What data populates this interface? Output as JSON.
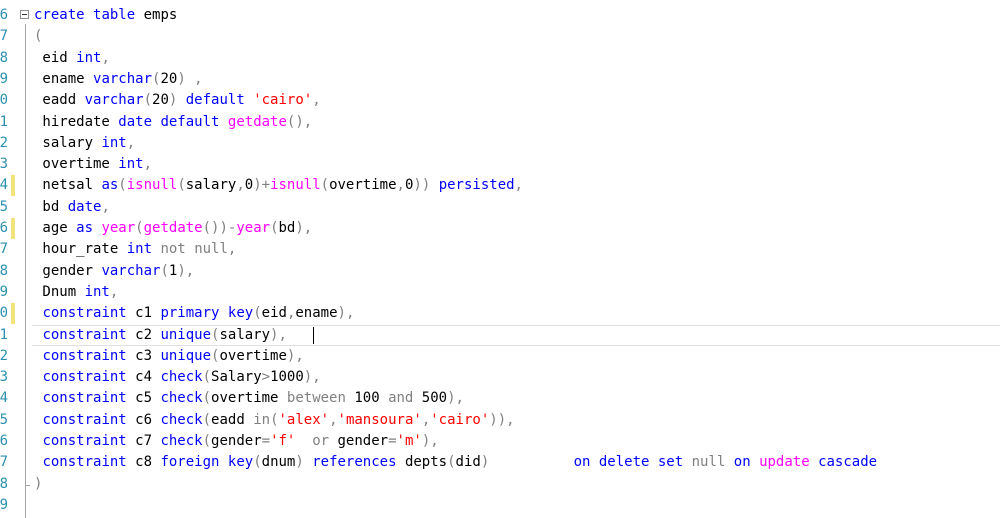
{
  "editor": {
    "line_numbers": [
      "6",
      "7",
      "8",
      "9",
      "0",
      "1",
      "2",
      "3",
      "4",
      "5",
      "6",
      "7",
      "8",
      "9",
      "0",
      "1",
      "2",
      "3",
      "4",
      "5",
      "6",
      "7",
      "8",
      "9"
    ],
    "changed_lines": [
      8,
      10,
      14
    ],
    "caret_line": 15,
    "lines": [
      [
        {
          "t": "create",
          "c": "kw"
        },
        {
          "t": " ",
          "c": "txt"
        },
        {
          "t": "table",
          "c": "kw"
        },
        {
          "t": " emps",
          "c": "txt"
        }
      ],
      [
        {
          "t": "(",
          "c": "gray"
        }
      ],
      [
        {
          "t": " eid ",
          "c": "txt"
        },
        {
          "t": "int",
          "c": "kw"
        },
        {
          "t": ",",
          "c": "gray"
        }
      ],
      [
        {
          "t": " ename ",
          "c": "txt"
        },
        {
          "t": "varchar",
          "c": "kw"
        },
        {
          "t": "(",
          "c": "gray"
        },
        {
          "t": "20",
          "c": "txt"
        },
        {
          "t": ") ,",
          "c": "gray"
        }
      ],
      [
        {
          "t": " eadd ",
          "c": "txt"
        },
        {
          "t": "varchar",
          "c": "kw"
        },
        {
          "t": "(",
          "c": "gray"
        },
        {
          "t": "20",
          "c": "txt"
        },
        {
          "t": ") ",
          "c": "gray"
        },
        {
          "t": "default",
          "c": "kw"
        },
        {
          "t": " ",
          "c": "txt"
        },
        {
          "t": "'cairo'",
          "c": "str"
        },
        {
          "t": ",",
          "c": "gray"
        }
      ],
      [
        {
          "t": " hiredate ",
          "c": "txt"
        },
        {
          "t": "date",
          "c": "kw"
        },
        {
          "t": " ",
          "c": "txt"
        },
        {
          "t": "default",
          "c": "kw"
        },
        {
          "t": " ",
          "c": "txt"
        },
        {
          "t": "getdate",
          "c": "fn"
        },
        {
          "t": "(),",
          "c": "gray"
        }
      ],
      [
        {
          "t": " salary ",
          "c": "txt"
        },
        {
          "t": "int",
          "c": "kw"
        },
        {
          "t": ",",
          "c": "gray"
        }
      ],
      [
        {
          "t": " overtime ",
          "c": "txt"
        },
        {
          "t": "int",
          "c": "kw"
        },
        {
          "t": ",",
          "c": "gray"
        }
      ],
      [
        {
          "t": " netsal ",
          "c": "txt"
        },
        {
          "t": "as",
          "c": "kw"
        },
        {
          "t": "(",
          "c": "gray"
        },
        {
          "t": "isnull",
          "c": "fn"
        },
        {
          "t": "(",
          "c": "gray"
        },
        {
          "t": "salary",
          "c": "txt"
        },
        {
          "t": ",",
          "c": "gray"
        },
        {
          "t": "0",
          "c": "txt"
        },
        {
          "t": ")+",
          "c": "gray"
        },
        {
          "t": "isnull",
          "c": "fn"
        },
        {
          "t": "(",
          "c": "gray"
        },
        {
          "t": "overtime",
          "c": "txt"
        },
        {
          "t": ",",
          "c": "gray"
        },
        {
          "t": "0",
          "c": "txt"
        },
        {
          "t": ")) ",
          "c": "gray"
        },
        {
          "t": "persisted",
          "c": "kw"
        },
        {
          "t": ",",
          "c": "gray"
        }
      ],
      [
        {
          "t": " bd ",
          "c": "txt"
        },
        {
          "t": "date",
          "c": "kw"
        },
        {
          "t": ",",
          "c": "gray"
        }
      ],
      [
        {
          "t": " age ",
          "c": "txt"
        },
        {
          "t": "as",
          "c": "kw"
        },
        {
          "t": " ",
          "c": "txt"
        },
        {
          "t": "year",
          "c": "fn"
        },
        {
          "t": "(",
          "c": "gray"
        },
        {
          "t": "getdate",
          "c": "fn"
        },
        {
          "t": "())-",
          "c": "gray"
        },
        {
          "t": "year",
          "c": "fn"
        },
        {
          "t": "(",
          "c": "gray"
        },
        {
          "t": "bd",
          "c": "txt"
        },
        {
          "t": "),",
          "c": "gray"
        }
      ],
      [
        {
          "t": " hour_rate ",
          "c": "txt"
        },
        {
          "t": "int",
          "c": "kw"
        },
        {
          "t": " ",
          "c": "txt"
        },
        {
          "t": "not",
          "c": "gray"
        },
        {
          "t": " ",
          "c": "txt"
        },
        {
          "t": "null",
          "c": "gray"
        },
        {
          "t": ",",
          "c": "gray"
        }
      ],
      [
        {
          "t": " gender ",
          "c": "txt"
        },
        {
          "t": "varchar",
          "c": "kw"
        },
        {
          "t": "(",
          "c": "gray"
        },
        {
          "t": "1",
          "c": "txt"
        },
        {
          "t": "),",
          "c": "gray"
        }
      ],
      [
        {
          "t": " Dnum ",
          "c": "txt"
        },
        {
          "t": "int",
          "c": "kw"
        },
        {
          "t": ",",
          "c": "gray"
        }
      ],
      [
        {
          "t": " ",
          "c": "txt"
        },
        {
          "t": "constraint",
          "c": "kw"
        },
        {
          "t": " c1 ",
          "c": "txt"
        },
        {
          "t": "primary",
          "c": "kw"
        },
        {
          "t": " ",
          "c": "txt"
        },
        {
          "t": "key",
          "c": "kw"
        },
        {
          "t": "(",
          "c": "gray"
        },
        {
          "t": "eid",
          "c": "txt"
        },
        {
          "t": ",",
          "c": "gray"
        },
        {
          "t": "ename",
          "c": "txt"
        },
        {
          "t": "),",
          "c": "gray"
        }
      ],
      [
        {
          "t": " ",
          "c": "txt"
        },
        {
          "t": "constraint",
          "c": "kw"
        },
        {
          "t": " c2 ",
          "c": "txt"
        },
        {
          "t": "unique",
          "c": "kw"
        },
        {
          "t": "(",
          "c": "gray"
        },
        {
          "t": "salary",
          "c": "txt"
        },
        {
          "t": "), ",
          "c": "gray"
        }
      ],
      [
        {
          "t": " ",
          "c": "txt"
        },
        {
          "t": "constraint",
          "c": "kw"
        },
        {
          "t": " c3 ",
          "c": "txt"
        },
        {
          "t": "unique",
          "c": "kw"
        },
        {
          "t": "(",
          "c": "gray"
        },
        {
          "t": "overtime",
          "c": "txt"
        },
        {
          "t": "),",
          "c": "gray"
        }
      ],
      [
        {
          "t": " ",
          "c": "txt"
        },
        {
          "t": "constraint",
          "c": "kw"
        },
        {
          "t": " c4 ",
          "c": "txt"
        },
        {
          "t": "check",
          "c": "kw"
        },
        {
          "t": "(",
          "c": "gray"
        },
        {
          "t": "Salary",
          "c": "txt"
        },
        {
          "t": ">",
          "c": "gray"
        },
        {
          "t": "1000",
          "c": "txt"
        },
        {
          "t": "),",
          "c": "gray"
        }
      ],
      [
        {
          "t": " ",
          "c": "txt"
        },
        {
          "t": "constraint",
          "c": "kw"
        },
        {
          "t": " c5 ",
          "c": "txt"
        },
        {
          "t": "check",
          "c": "kw"
        },
        {
          "t": "(",
          "c": "gray"
        },
        {
          "t": "overtime ",
          "c": "txt"
        },
        {
          "t": "between",
          "c": "gray"
        },
        {
          "t": " 100 ",
          "c": "txt"
        },
        {
          "t": "and",
          "c": "gray"
        },
        {
          "t": " 500",
          "c": "txt"
        },
        {
          "t": "),",
          "c": "gray"
        }
      ],
      [
        {
          "t": " ",
          "c": "txt"
        },
        {
          "t": "constraint",
          "c": "kw"
        },
        {
          "t": " c6 ",
          "c": "txt"
        },
        {
          "t": "check",
          "c": "kw"
        },
        {
          "t": "(",
          "c": "gray"
        },
        {
          "t": "eadd ",
          "c": "txt"
        },
        {
          "t": "in",
          "c": "gray"
        },
        {
          "t": "(",
          "c": "gray"
        },
        {
          "t": "'alex'",
          "c": "str"
        },
        {
          "t": ",",
          "c": "gray"
        },
        {
          "t": "'mansoura'",
          "c": "str"
        },
        {
          "t": ",",
          "c": "gray"
        },
        {
          "t": "'cairo'",
          "c": "str"
        },
        {
          "t": ")),",
          "c": "gray"
        }
      ],
      [
        {
          "t": " ",
          "c": "txt"
        },
        {
          "t": "constraint",
          "c": "kw"
        },
        {
          "t": " c7 ",
          "c": "txt"
        },
        {
          "t": "check",
          "c": "kw"
        },
        {
          "t": "(",
          "c": "gray"
        },
        {
          "t": "gender",
          "c": "txt"
        },
        {
          "t": "=",
          "c": "gray"
        },
        {
          "t": "'f'",
          "c": "str"
        },
        {
          "t": "  ",
          "c": "txt"
        },
        {
          "t": "or",
          "c": "gray"
        },
        {
          "t": " gender",
          "c": "txt"
        },
        {
          "t": "=",
          "c": "gray"
        },
        {
          "t": "'m'",
          "c": "str"
        },
        {
          "t": "),",
          "c": "gray"
        }
      ],
      [
        {
          "t": " ",
          "c": "txt"
        },
        {
          "t": "constraint",
          "c": "kw"
        },
        {
          "t": " c8 ",
          "c": "txt"
        },
        {
          "t": "foreign",
          "c": "kw"
        },
        {
          "t": " ",
          "c": "txt"
        },
        {
          "t": "key",
          "c": "kw"
        },
        {
          "t": "(",
          "c": "gray"
        },
        {
          "t": "dnum",
          "c": "txt"
        },
        {
          "t": ") ",
          "c": "gray"
        },
        {
          "t": "references",
          "c": "kw"
        },
        {
          "t": " depts",
          "c": "txt"
        },
        {
          "t": "(",
          "c": "gray"
        },
        {
          "t": "did",
          "c": "txt"
        },
        {
          "t": ")",
          "c": "gray"
        },
        {
          "t": "          ",
          "c": "txt"
        },
        {
          "t": "on",
          "c": "kw"
        },
        {
          "t": " ",
          "c": "txt"
        },
        {
          "t": "delete",
          "c": "kw"
        },
        {
          "t": " ",
          "c": "txt"
        },
        {
          "t": "set",
          "c": "kw"
        },
        {
          "t": " ",
          "c": "txt"
        },
        {
          "t": "null",
          "c": "gray"
        },
        {
          "t": " ",
          "c": "txt"
        },
        {
          "t": "on",
          "c": "kw"
        },
        {
          "t": " ",
          "c": "txt"
        },
        {
          "t": "update",
          "c": "fn"
        },
        {
          "t": " ",
          "c": "txt"
        },
        {
          "t": "cascade",
          "c": "kw"
        }
      ],
      [
        {
          "t": ")",
          "c": "gray"
        }
      ],
      []
    ]
  },
  "colors": {
    "keyword": "#0000ff",
    "function": "#ff00ff",
    "string": "#ff0000",
    "operator": "#808080",
    "identifier": "#000000",
    "line_number": "#2b91af",
    "change_marker": "#f3e37c",
    "fold_icon": "collapse-minus-icon"
  }
}
